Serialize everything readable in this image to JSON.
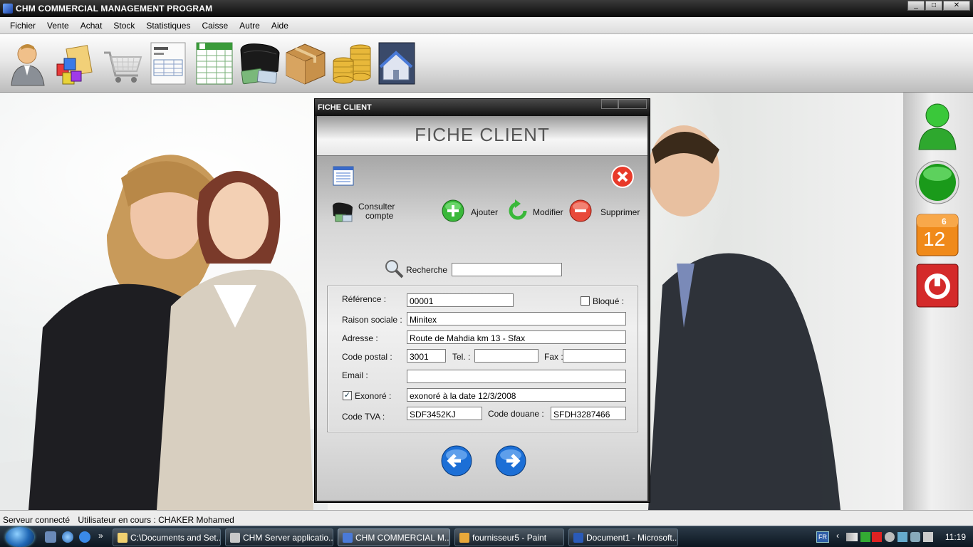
{
  "window": {
    "title": "CHM COMMERCIAL MANAGEMENT PROGRAM",
    "controls": [
      "_",
      "□",
      "✕"
    ]
  },
  "menu": [
    "Fichier",
    "Vente",
    "Achat",
    "Stock",
    "Statistiques",
    "Caisse",
    "Autre",
    "Aide"
  ],
  "toolbar": {
    "icons": [
      "user-icon",
      "products-icon",
      "cart-icon",
      "invoice-icon",
      "spreadsheet-icon",
      "wallet-icon",
      "box-icon",
      "coins-icon",
      "home-icon"
    ]
  },
  "right_panel": {
    "icons": [
      "online-user-icon",
      "green-orb-icon",
      "calendar-icon",
      "power-icon"
    ],
    "calendar": {
      "small": "6",
      "big": "12"
    }
  },
  "dialog": {
    "title": "FICHE CLIENT",
    "header": "FICHE CLIENT",
    "consulter_label_1": "Consulter",
    "consulter_label_2": "compte",
    "ajouter": "Ajouter",
    "modifier": "Modifier",
    "supprimer": "Supprimer",
    "search_label": "Recherche",
    "search_value": "",
    "fields": {
      "reference_label": "Référence :",
      "reference_value": "00001",
      "bloque_label": "Bloqué :",
      "bloque_checked": false,
      "raison_label": "Raison sociale :",
      "raison_value": "Minitex",
      "adresse_label": "Adresse :",
      "adresse_value": "Route de Mahdia km 13 - Sfax",
      "code_postal_label": "Code postal :",
      "code_postal_value": "3001",
      "tel_label": "Tel. :",
      "tel_value": "",
      "fax_label": "Fax :",
      "fax_value": "",
      "email_label": "Email :",
      "email_value": "",
      "exonore_label": "Exonoré :",
      "exonore_checked": true,
      "exonore_value": "exonoré à la date 12/3/2008",
      "tva_label": "Code TVA :",
      "tva_value": "SDF3452KJ",
      "douane_label": "Code douane :",
      "douane_value": "SFDH3287466"
    }
  },
  "status": {
    "server": "Serveur connecté",
    "user": "Utilisateur en cours : CHAKER Mohamed"
  },
  "taskbar": {
    "tasks": [
      {
        "label": "C:\\Documents and Set..."
      },
      {
        "label": "CHM Server applicatio..."
      },
      {
        "label": "CHM COMMERCIAL M..."
      },
      {
        "label": "fournisseur5 - Paint"
      },
      {
        "label": "Document1 - Microsoft..."
      }
    ],
    "lang": "FR",
    "clock": "11:19"
  },
  "colors": {
    "accent_green": "#2ea82e",
    "delete_red": "#e03a2a",
    "nav_blue": "#1c6fd6"
  }
}
